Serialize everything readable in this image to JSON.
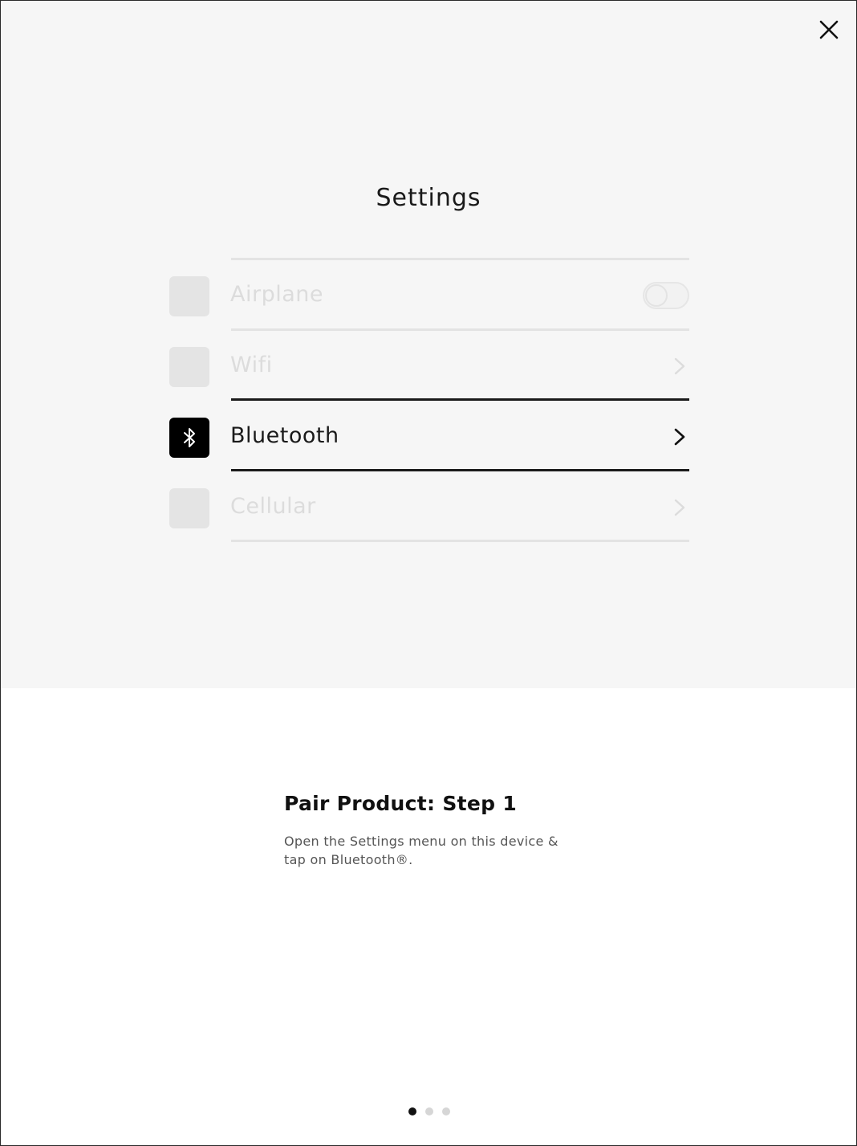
{
  "illustration": {
    "title": "Settings",
    "rows": [
      {
        "label": "Airplane",
        "icon": "airplane-icon",
        "control": "toggle",
        "toggle_on": false,
        "highlighted": false
      },
      {
        "label": "Wifi",
        "icon": "wifi-icon",
        "control": "chevron",
        "highlighted": false
      },
      {
        "label": "Bluetooth",
        "icon": "bluetooth-icon",
        "control": "chevron",
        "highlighted": true
      },
      {
        "label": "Cellular",
        "icon": "cellular-icon",
        "control": "chevron",
        "highlighted": false
      }
    ]
  },
  "instruction": {
    "title": "Pair Product: Step 1",
    "description": "Open the Settings menu on this device & tap on Bluetooth®."
  },
  "pager": {
    "total": 3,
    "current": 1
  },
  "colors": {
    "illustration_bg": "#f6f6f6",
    "active": "#111111",
    "inactive": "#dcdcdc"
  }
}
